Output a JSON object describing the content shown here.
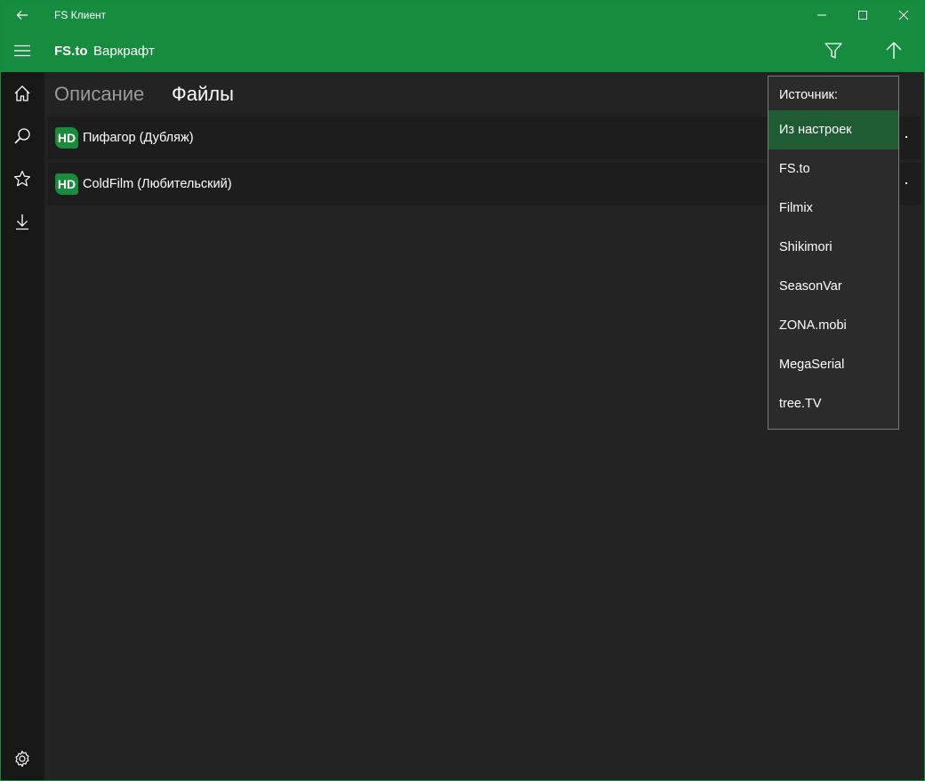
{
  "window": {
    "title": "FS Клиент"
  },
  "header": {
    "brand": "FS.to",
    "movie_title": "Варкрафт"
  },
  "tabs": [
    {
      "label": "Описание",
      "active": false
    },
    {
      "label": "Файлы",
      "active": true
    }
  ],
  "files": [
    {
      "badge": "HD",
      "label": "Пифагор (Дубляж)"
    },
    {
      "badge": "HD",
      "label": "ColdFilm (Любительский)"
    }
  ],
  "source_menu": {
    "header": "Источник:",
    "items": [
      {
        "label": "Из настроек",
        "selected": true
      },
      {
        "label": "FS.to"
      },
      {
        "label": "Filmix"
      },
      {
        "label": "Shikimori"
      },
      {
        "label": "SeasonVar"
      },
      {
        "label": "ZONA.mobi"
      },
      {
        "label": "MegaSerial"
      },
      {
        "label": "tree.TV"
      }
    ]
  },
  "icons": {
    "back": "back-arrow-icon",
    "minimize": "minimize-icon",
    "maximize": "maximize-icon",
    "close": "close-icon",
    "menu": "hamburger-icon",
    "filter": "filter-icon",
    "up": "up-arrow-icon",
    "home": "home-icon",
    "search": "search-icon",
    "favorites": "star-icon",
    "downloads": "download-icon",
    "settings": "gear-icon"
  },
  "colors": {
    "accent": "#168c3f",
    "badge": "#1a8a3d",
    "selected_item": "#1f5c33"
  }
}
